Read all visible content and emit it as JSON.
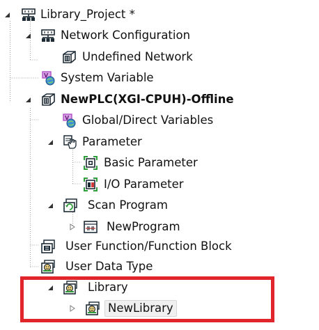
{
  "tree": {
    "nodes": [
      {
        "label": "Library_Project *",
        "icon": "project-network-icon",
        "toggle": "expanded",
        "bold": false
      },
      {
        "label": "Network Configuration",
        "icon": "network-config-icon",
        "toggle": "expanded",
        "bold": false
      },
      {
        "label": "Undefined Network",
        "icon": "plc-cube-icon",
        "toggle": "none",
        "bold": false
      },
      {
        "label": "System Variable",
        "icon": "system-variable-icon",
        "toggle": "none",
        "bold": false
      },
      {
        "label": "NewPLC(XGI-CPUH)-Offline",
        "icon": "plc-cube-icon",
        "toggle": "expanded",
        "bold": true
      },
      {
        "label": "Global/Direct Variables",
        "icon": "global-variable-icon",
        "toggle": "none",
        "bold": false
      },
      {
        "label": "Parameter",
        "icon": "parameter-hand-icon",
        "toggle": "expanded",
        "bold": false
      },
      {
        "label": "Basic Parameter",
        "icon": "basic-parameter-icon",
        "toggle": "none",
        "bold": false
      },
      {
        "label": "I/O Parameter",
        "icon": "io-parameter-icon",
        "toggle": "none",
        "bold": false
      },
      {
        "label": "Scan Program",
        "icon": "scan-program-icon",
        "toggle": "expanded",
        "bold": false
      },
      {
        "label": "NewProgram",
        "icon": "program-icon",
        "toggle": "collapsed",
        "bold": false
      },
      {
        "label": "User Function/Function Block",
        "icon": "function-block-icon",
        "toggle": "none",
        "bold": false
      },
      {
        "label": "User Data Type",
        "icon": "data-type-icon",
        "toggle": "none",
        "bold": false
      },
      {
        "label": "Library",
        "icon": "library-icon",
        "toggle": "expanded",
        "bold": false
      },
      {
        "label": "NewLibrary",
        "icon": "new-library-icon",
        "toggle": "collapsed",
        "bold": false,
        "selected": true
      }
    ]
  },
  "colors": {
    "highlight_border": "#e0262b",
    "guide_line": "#a0a0a0",
    "icon_dark": "#1d2b36",
    "icon_green": "#2e9e3a",
    "icon_purple": "#b04fc4",
    "icon_red": "#d23a3a"
  }
}
